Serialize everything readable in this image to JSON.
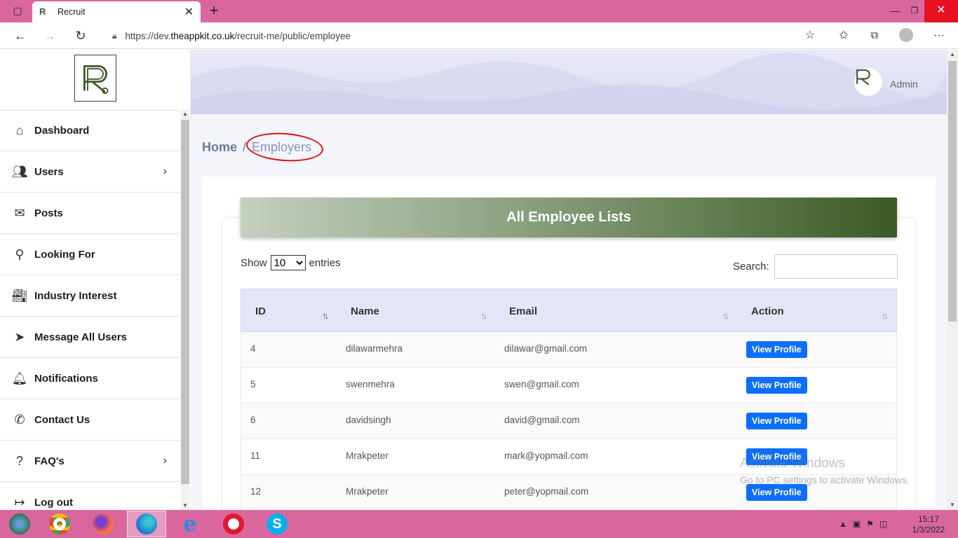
{
  "browser": {
    "tab_title": "Recruit",
    "url_prefix": "https://dev.",
    "url_domain": "theappkit.co.uk",
    "url_path": "/recruit-me/public/employee"
  },
  "sidebar": {
    "items": [
      {
        "label": "Dashboard",
        "icon": "home-icon"
      },
      {
        "label": "Users",
        "icon": "users-icon",
        "chevron": true
      },
      {
        "label": "Posts",
        "icon": "posts-icon"
      },
      {
        "label": "Looking For",
        "icon": "looking-for-icon"
      },
      {
        "label": "Industry Interest",
        "icon": "industry-icon"
      },
      {
        "label": "Message All Users",
        "icon": "send-icon"
      },
      {
        "label": "Notifications",
        "icon": "bell-icon"
      },
      {
        "label": "Contact Us",
        "icon": "phone-icon"
      },
      {
        "label": "FAQ's",
        "icon": "faq-icon",
        "chevron": true
      },
      {
        "label": "Log out",
        "icon": "logout-icon"
      }
    ]
  },
  "header": {
    "user_name": "Admin"
  },
  "breadcrumb": {
    "home": "Home",
    "separator": "/",
    "current": "Employers"
  },
  "card": {
    "title": "All Employee Lists",
    "show_label": "Show",
    "entries_value": "10",
    "entries_label": "entries",
    "search_label": "Search:",
    "search_value": ""
  },
  "table": {
    "columns": [
      "ID",
      "Name",
      "Email",
      "Action"
    ],
    "rows": [
      {
        "id": "4",
        "name": "dilawarmehra",
        "email": "dilawar@gmail.com",
        "action": "View Profile"
      },
      {
        "id": "5",
        "name": "swenmehra",
        "email": "swen@gmail.com",
        "action": "View Profile"
      },
      {
        "id": "6",
        "name": "davidsingh",
        "email": "david@gmail.com",
        "action": "View Profile"
      },
      {
        "id": "11",
        "name": "Mrakpeter",
        "email": "mark@yopmail.com",
        "action": "View Profile"
      },
      {
        "id": "12",
        "name": "Mrakpeter",
        "email": "peter@yopmail.com",
        "action": "View Profile"
      }
    ]
  },
  "watermark": {
    "line1": "Activate Windows",
    "line2": "Go to PC settings to activate Windows."
  },
  "taskbar": {
    "time": "15:17",
    "date": "1/3/2022"
  },
  "colors": {
    "accent_green": "#3c5a25",
    "button_blue": "#0d6efd",
    "chrome_pink": "#d9679e",
    "annotation_red": "#dd1111"
  }
}
